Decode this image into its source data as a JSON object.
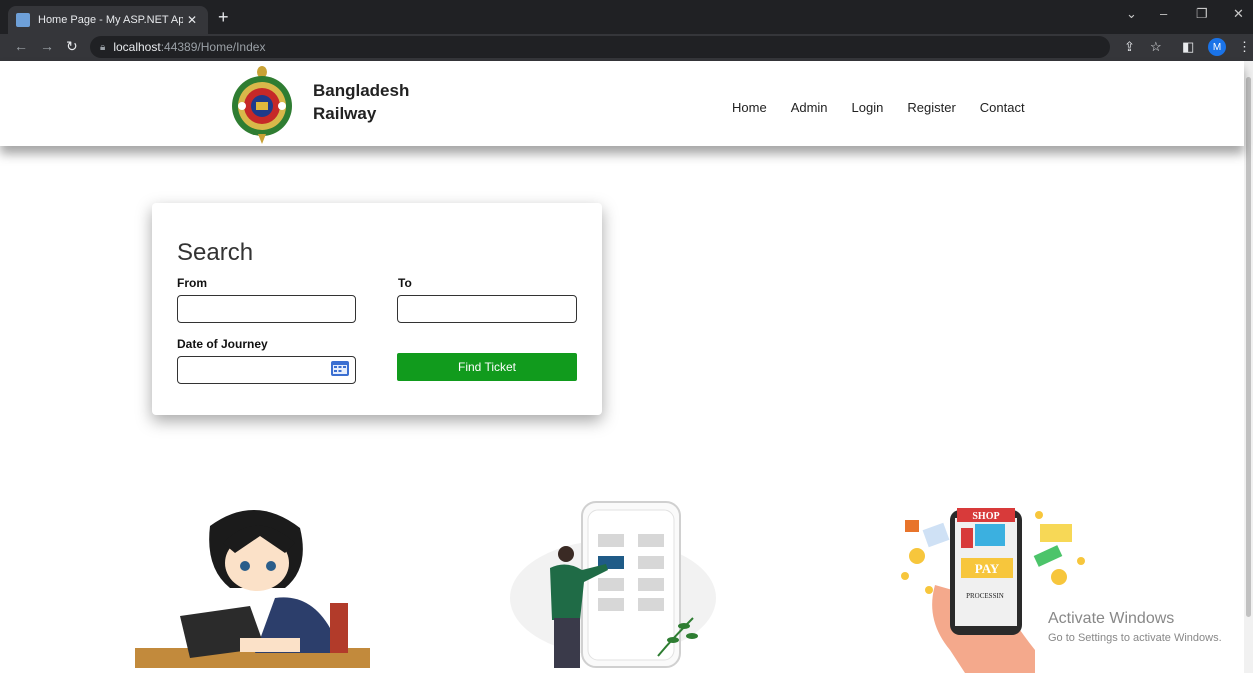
{
  "browser": {
    "tab_title": "Home Page - My ASP.NET Applic",
    "tab_close": "✕",
    "new_tab": "+",
    "url_host": "localhost",
    "url_path": ":44389/Home/Index",
    "profile_initial": "M"
  },
  "header": {
    "brand_line1": "Bangladesh",
    "brand_line2": "Railway",
    "nav": [
      "Home",
      "Admin",
      "Login",
      "Register",
      "Contact"
    ]
  },
  "search": {
    "title": "Search",
    "from_label": "From",
    "to_label": "To",
    "date_label": "Date of Journey",
    "from_value": "",
    "to_value": "",
    "date_value": "",
    "find_button": "Find Ticket"
  },
  "illustrations": {
    "shop_sign": "SHOP",
    "pay_sign": "PAY",
    "processing": "PROCESSIN"
  },
  "watermark": {
    "line1": "Activate Windows",
    "line2": "Go to Settings to activate Windows."
  },
  "colors": {
    "find_button": "#119b1d",
    "chrome_dark": "#202124"
  }
}
